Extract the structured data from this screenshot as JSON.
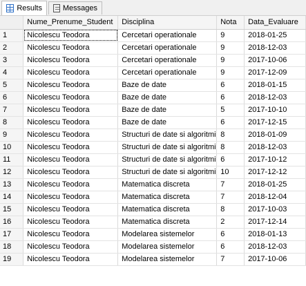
{
  "tabs": {
    "results_label": "Results",
    "messages_label": "Messages"
  },
  "columns": [
    "",
    "Nume_Prenume_Student",
    "Disciplina",
    "Nota",
    "Data_Evaluare"
  ],
  "rows": [
    [
      "1",
      "Nicolescu Teodora",
      "Cercetari operationale",
      "9",
      "2018-01-25"
    ],
    [
      "2",
      "Nicolescu Teodora",
      "Cercetari operationale",
      "9",
      "2018-12-03"
    ],
    [
      "3",
      "Nicolescu Teodora",
      "Cercetari operationale",
      "9",
      "2017-10-06"
    ],
    [
      "4",
      "Nicolescu Teodora",
      "Cercetari operationale",
      "9",
      "2017-12-09"
    ],
    [
      "5",
      "Nicolescu Teodora",
      "Baze de date",
      "6",
      "2018-01-15"
    ],
    [
      "6",
      "Nicolescu Teodora",
      "Baze de date",
      "6",
      "2018-12-03"
    ],
    [
      "7",
      "Nicolescu Teodora",
      "Baze de date",
      "5",
      "2017-10-10"
    ],
    [
      "8",
      "Nicolescu Teodora",
      "Baze de date",
      "6",
      "2017-12-15"
    ],
    [
      "9",
      "Nicolescu Teodora",
      "Structuri de date si algoritmi",
      "8",
      "2018-01-09"
    ],
    [
      "10",
      "Nicolescu Teodora",
      "Structuri de date si algoritmi",
      "8",
      "2018-12-03"
    ],
    [
      "11",
      "Nicolescu Teodora",
      "Structuri de date si algoritmi",
      "6",
      "2017-10-12"
    ],
    [
      "12",
      "Nicolescu Teodora",
      "Structuri de date si algoritmi",
      "10",
      "2017-12-12"
    ],
    [
      "13",
      "Nicolescu Teodora",
      "Matematica discreta",
      "7",
      "2018-01-25"
    ],
    [
      "14",
      "Nicolescu Teodora",
      "Matematica discreta",
      "7",
      "2018-12-04"
    ],
    [
      "15",
      "Nicolescu Teodora",
      "Matematica discreta",
      "8",
      "2017-10-03"
    ],
    [
      "16",
      "Nicolescu Teodora",
      "Matematica discreta",
      "2",
      "2017-12-14"
    ],
    [
      "17",
      "Nicolescu Teodora",
      "Modelarea sistemelor",
      "6",
      "2018-01-13"
    ],
    [
      "18",
      "Nicolescu Teodora",
      "Modelarea sistemelor",
      "6",
      "2018-12-03"
    ],
    [
      "19",
      "Nicolescu Teodora",
      "Modelarea sistemelor",
      "7",
      "2017-10-06"
    ]
  ]
}
